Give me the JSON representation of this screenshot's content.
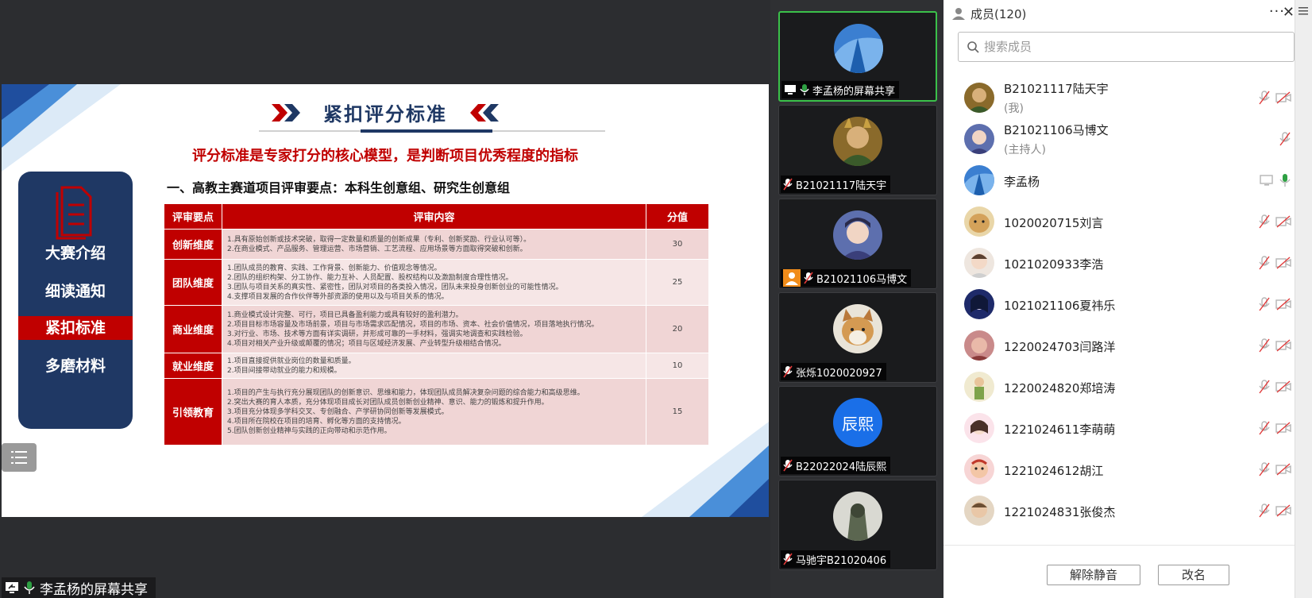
{
  "slide": {
    "title": "紧扣评分标准",
    "subtitle": "评分标准是专家打分的核心模型，是判断项目优秀程度的指标",
    "section_heading": "一、高教主赛道项目评审要点：本科生创意组、研究生创意组",
    "nav_items": [
      {
        "label": "大赛介绍",
        "active": false
      },
      {
        "label": "细读通知",
        "active": false
      },
      {
        "label": "紧扣标准",
        "active": true
      },
      {
        "label": "多磨材料",
        "active": false
      }
    ],
    "table": {
      "headers": [
        "评审要点",
        "评审内容",
        "分值"
      ],
      "rows": [
        {
          "dimension": "创新维度",
          "score": "30",
          "lines": [
            "1.具有原始创新或技术突破，取得一定数量和质量的创新成果（专利、创新奖励、行业认可等）。",
            "2.在商业模式、产品服务、管理运营、市场营销、工艺流程、应用场景等方面取得突破和创新。"
          ]
        },
        {
          "dimension": "团队维度",
          "score": "25",
          "lines": [
            "1.团队成员的教育、实践、工作背景、创新能力、价值观念等情况。",
            "2.团队的组织构架、分工协作、能力互补、人员配置、股权结构以及激励制度合理性情况。",
            "3.团队与项目关系的真实性、紧密性，团队对项目的各类投入情况，团队未来投身创新创业的可能性情况。",
            "4.支撑项目发展的合作伙伴等外部资源的使用以及与项目关系的情况。"
          ]
        },
        {
          "dimension": "商业维度",
          "score": "20",
          "lines": [
            "1.商业模式设计完整、可行，项目已具备盈利能力或具有较好的盈利潜力。",
            "2.项目目标市场容量及市场前景，项目与市场需求匹配情况，项目的市场、资本、社会价值情况，项目落地执行情况。",
            "3.对行业、市场、技术等方面有详实调研，并形成可靠的一手材料，强调实地调查和实践检验。",
            "4.项目对相关产业升级或颠覆的情况；项目与区域经济发展、产业转型升级相结合情况。"
          ]
        },
        {
          "dimension": "就业维度",
          "score": "10",
          "lines": [
            "1.项目直接提供就业岗位的数量和质量。",
            "2.项目间接带动就业的能力和规模。"
          ]
        },
        {
          "dimension": "引领教育",
          "score": "15",
          "lines": [
            "1.项目的产生与执行充分展现团队的创新意识、思维和能力，体现团队成员解决复杂问题的综合能力和高级思维。",
            "2.突出大赛的育人本质，充分体现项目成长对团队成员创新创业精神、意识、能力的锻炼和提升作用。",
            "3.项目充分体现多学科交叉、专创融合、产学研协同创新等发展模式。",
            "4.项目所在院校在项目的培育、孵化等方面的支持情况。",
            "5.团队创新创业精神与实践的正向带动和示范作用。"
          ]
        }
      ]
    }
  },
  "stage": {
    "share_label": "李孟杨的屏幕共享",
    "menu_icon": "list-icon"
  },
  "tiles": [
    {
      "name": "李孟杨的屏幕共享",
      "speaking": true,
      "mic": "on",
      "screen": true
    },
    {
      "name": "B21021117陆天宇",
      "speaking": false,
      "mic": "off"
    },
    {
      "name": "B21021106马博文",
      "speaking": false,
      "mic": "off",
      "badge": true
    },
    {
      "name": "张烁1020020927",
      "speaking": false,
      "mic": "off"
    },
    {
      "name": "B22022024陆辰熙",
      "speaking": false,
      "mic": "off",
      "avatar_text": "辰熙"
    },
    {
      "name": "马驰宇B21020406",
      "speaking": false,
      "mic": "off"
    }
  ],
  "panel": {
    "title": "成员(120)",
    "more": "···",
    "close": "✕",
    "search_placeholder": "搜索成员",
    "members": [
      {
        "name": "B21021117陆天宇",
        "role": "(我)",
        "mic": "off",
        "cam": "off"
      },
      {
        "name": "B21021106马博文",
        "role": "(主持人)",
        "mic": "off",
        "cam": "none"
      },
      {
        "name": "李孟杨",
        "role": "",
        "mic": "on",
        "cam": "screen"
      },
      {
        "name": "1020020715刘言",
        "role": "",
        "mic": "off",
        "cam": "off"
      },
      {
        "name": "1021020933李浩",
        "role": "",
        "mic": "off",
        "cam": "off"
      },
      {
        "name": "1021021106夏祎乐",
        "role": "",
        "mic": "off",
        "cam": "off"
      },
      {
        "name": "1220024703闫路洋",
        "role": "",
        "mic": "off",
        "cam": "off"
      },
      {
        "name": "1220024820郑培涛",
        "role": "",
        "mic": "off",
        "cam": "off"
      },
      {
        "name": "1221024611李萌萌",
        "role": "",
        "mic": "off",
        "cam": "off"
      },
      {
        "name": "1221024612胡江",
        "role": "",
        "mic": "off",
        "cam": "off"
      },
      {
        "name": "1221024831张俊杰",
        "role": "",
        "mic": "off",
        "cam": "off"
      }
    ],
    "footer": {
      "unmute_label": "解除静音",
      "rename_label": "改名"
    }
  },
  "colors": {
    "brand_navy": "#1f3864",
    "brand_red": "#c00000",
    "speaking_green": "#3bc14a",
    "mic_on_green": "#2ea043",
    "mic_off_gray": "#b5b5b5"
  }
}
